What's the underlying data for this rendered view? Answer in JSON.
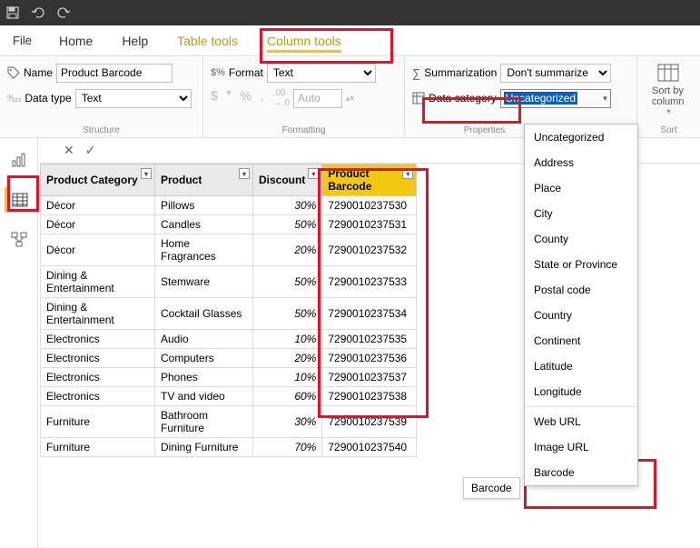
{
  "titlebar": {
    "save": "save-icon",
    "undo": "undo-icon",
    "redo": "redo-icon"
  },
  "menu": {
    "file": "File",
    "home": "Home",
    "help": "Help",
    "table_tools": "Table tools",
    "column_tools": "Column tools"
  },
  "ribbon": {
    "structure": {
      "label": "Structure",
      "name_label": "Name",
      "name_value": "Product Barcode",
      "datatype_label": "Data type",
      "datatype_value": "Text"
    },
    "formatting": {
      "label": "Formatting",
      "format_label": "Format",
      "format_value": "Text",
      "auto": "Auto",
      "currency": "$",
      "percent": "%",
      "comma": ",",
      "decimals": ".00"
    },
    "properties": {
      "label": "Properties",
      "summarization_label": "Summarization",
      "summarization_value": "Don't summarize",
      "data_category_label": "Data category",
      "data_category_value": "Uncategorized"
    },
    "sort": {
      "label": "Sort",
      "button": "Sort by column"
    }
  },
  "table": {
    "headers": [
      "Product Category",
      "Product",
      "Discount",
      "Product Barcode"
    ],
    "rows": [
      [
        "Décor",
        "Pillows",
        "30%",
        "7290010237530"
      ],
      [
        "Décor",
        "Candles",
        "50%",
        "7290010237531"
      ],
      [
        "Décor",
        "Home Fragrances",
        "20%",
        "7290010237532"
      ],
      [
        "Dining & Entertainment",
        "Stemware",
        "50%",
        "7290010237533"
      ],
      [
        "Dining & Entertainment",
        "Cocktail Glasses",
        "50%",
        "7290010237534"
      ],
      [
        "Electronics",
        "Audio",
        "10%",
        "7290010237535"
      ],
      [
        "Electronics",
        "Computers",
        "20%",
        "7290010237536"
      ],
      [
        "Electronics",
        "Phones",
        "10%",
        "7290010237537"
      ],
      [
        "Electronics",
        "TV and video",
        "60%",
        "7290010237538"
      ],
      [
        "Furniture",
        "Bathroom Furniture",
        "30%",
        "7290010237539"
      ],
      [
        "Furniture",
        "Dining Furniture",
        "70%",
        "7290010237540"
      ]
    ]
  },
  "dropdown": {
    "items": [
      "Uncategorized",
      "Address",
      "Place",
      "City",
      "County",
      "State or Province",
      "Postal code",
      "Country",
      "Continent",
      "Latitude",
      "Longitude"
    ],
    "items2": [
      "Web URL",
      "Image URL",
      "Barcode"
    ]
  },
  "tooltip": {
    "barcode": "Barcode"
  }
}
